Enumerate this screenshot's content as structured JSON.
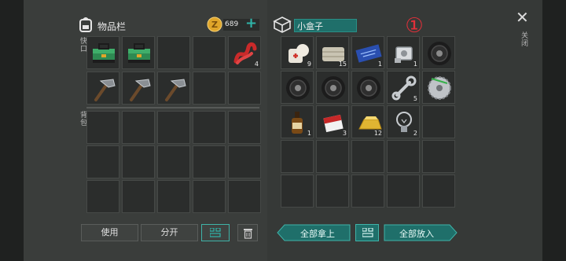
{
  "inventory": {
    "title": "物品栏",
    "section_quick": "快口",
    "section_backpack": "背包"
  },
  "coins": {
    "value": "689",
    "add_symbol": "+"
  },
  "box": {
    "title": "小盒子",
    "step_badge": "①"
  },
  "close": {
    "label": "关闭",
    "symbol": "✕"
  },
  "quick_slots": [
    {
      "icon": "toolbox-icon",
      "qty": ""
    },
    {
      "icon": "toolbox-icon",
      "qty": ""
    },
    {
      "icon": "",
      "qty": ""
    },
    {
      "icon": "",
      "qty": ""
    },
    {
      "icon": "red-rope-icon",
      "qty": "4"
    },
    {
      "icon": "hammer-icon",
      "qty": ""
    },
    {
      "icon": "hammer-icon",
      "qty": ""
    },
    {
      "icon": "hammer-icon",
      "qty": ""
    },
    {
      "icon": "",
      "qty": ""
    },
    {
      "icon": "",
      "qty": ""
    }
  ],
  "box_slots": [
    {
      "icon": "bandage-icon",
      "qty": "9"
    },
    {
      "icon": "fabric-icon",
      "qty": "15"
    },
    {
      "icon": "circuit-board-icon",
      "qty": "1"
    },
    {
      "icon": "engine-part-icon",
      "qty": "1"
    },
    {
      "icon": "tire-icon",
      "qty": ""
    },
    {
      "icon": "tire-icon",
      "qty": ""
    },
    {
      "icon": "tire-icon",
      "qty": ""
    },
    {
      "icon": "tire-icon",
      "qty": ""
    },
    {
      "icon": "wrench-icon",
      "qty": "5"
    },
    {
      "icon": "saw-blade-icon",
      "qty": ""
    },
    {
      "icon": "liquor-bottle-icon",
      "qty": "1"
    },
    {
      "icon": "cigarette-pack-icon",
      "qty": "3"
    },
    {
      "icon": "gold-bar-icon",
      "qty": "12"
    },
    {
      "icon": "light-bulb-icon",
      "qty": "2"
    },
    {
      "icon": "",
      "qty": ""
    }
  ],
  "buttons": {
    "use": "使用",
    "split": "分开",
    "take_all": "全部拿上",
    "put_all": "全部放入"
  },
  "colors": {
    "accent": "#2aa198",
    "badge": "#e0303a"
  }
}
